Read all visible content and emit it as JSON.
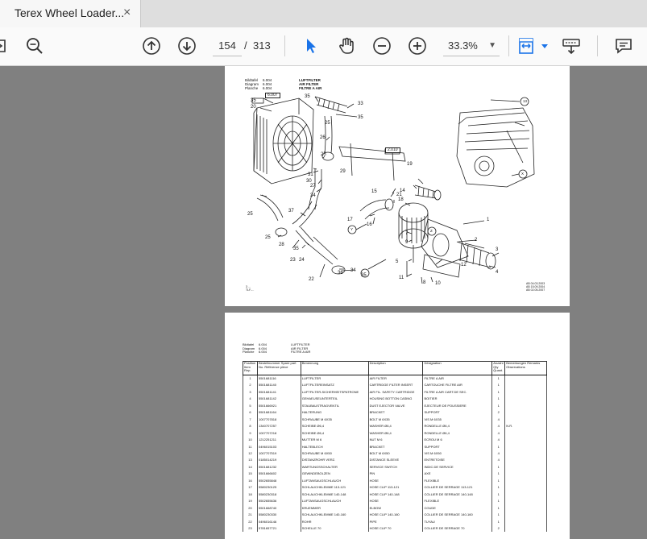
{
  "tab": {
    "title": "Terex Wheel Loader...",
    "close": "×"
  },
  "toolbar": {
    "page_current": "154",
    "page_sep": "/",
    "page_total": "313",
    "zoom": "33.3%",
    "icons": [
      "zoom-out-search-icon",
      "page-up-icon",
      "page-down-icon",
      "select-cursor-icon",
      "hand-pan-icon",
      "zoom-out-icon",
      "zoom-in-icon",
      "fit-page-icon",
      "chevron-down-icon",
      "download-icon",
      "comment-icon"
    ]
  },
  "page1": {
    "header_labels": [
      "Bildtafel",
      "Diagram",
      "Planche"
    ],
    "header_numbers": [
      "6.004",
      "6.004",
      "6.004"
    ],
    "header_titles": [
      "LUFTFILTER",
      "AIR FILTER",
      "FILTRE A AIR"
    ],
    "ref_box_1": "6.007",
    "ref_box_2": "2.010",
    "callouts": [
      "35",
      "20",
      "35",
      "33",
      "35",
      "25",
      "26",
      "25",
      "31",
      "30",
      "29",
      "27",
      "34",
      "37",
      "25",
      "25",
      "28",
      "35",
      "23",
      "24",
      "22",
      "36",
      "34",
      "35",
      "19",
      "15",
      "14",
      "18",
      "21",
      "17",
      "16",
      "1",
      "7",
      "9",
      "2",
      "3",
      "4",
      "5",
      "12",
      "11",
      "8",
      "10",
      "13",
      "Y",
      "Y",
      "X",
      "X",
      "Z",
      "Z"
    ],
    "footer_left": [
      "3 ...",
      "TLF-...",
      "..."
    ],
    "footer_right": [
      "AB 04.03.2003",
      "AB 15.09.2004",
      "AB 02.05.2007"
    ]
  },
  "page2": {
    "header_labels": [
      "Bildtafel",
      "Diagram",
      "Planche"
    ],
    "header_numbers": [
      "6.004",
      "6.004",
      "6.004"
    ],
    "header_titles": [
      "LUFTFILTER",
      "AIR FILTER",
      "FILTRE A AIR"
    ],
    "columns": [
      "Position Item Rep.",
      "Bestellnummer Spare part No. Référence pièce",
      "Benennung",
      "Description",
      "Désignation",
      "Anzahl Qty Quant.",
      "Bemerkungen Remarks Observations"
    ],
    "rows": [
      [
        "1",
        "5501681116",
        "LUFTFILTER",
        "AIR FILTER",
        "FILTRE A AIR",
        "1",
        ""
      ],
      [
        "2",
        "5501681140",
        "LUFTFILTEREINSATZ",
        "CARTRIDGE FILTER INSERT",
        "CARTOUCHE FILTRE AIR",
        "1",
        ""
      ],
      [
        "3",
        "5501681141",
        "LUFTFILTER-SICHERHEITSPATRONE",
        "AIR FIL. SAFETY CARTRIDGE",
        "FILTRE A AIR CART.DE SEC.",
        "1",
        ""
      ],
      [
        "4",
        "5501681142",
        "GEHAEUSEUNTERTEIL",
        "HOUSING BOTTON CASING",
        "BOITIER",
        "1",
        ""
      ],
      [
        "5",
        "5501666921",
        "STAUBAUSTRAGVENTIL",
        "DUST EJECTOR VALVE",
        "EJECTEUR DE POUSSIERE",
        "1",
        ""
      ],
      [
        "6",
        "5501681164",
        "HALTERUNG",
        "BRACKET",
        "SUPPORT",
        "2",
        ""
      ],
      [
        "7",
        "1007707818",
        "SCHRAUBE M 6X35",
        "BOLT M 6X35",
        "VIS M 6X35",
        "4",
        ""
      ],
      [
        "8",
        "1340707257",
        "SCHEIBE Ø6,4",
        "WASHER Ø6,4",
        "RONDELLE Ø6,4",
        "4",
        "N.R."
      ],
      [
        "9",
        "1007707218",
        "SCHEIBE Ø6,4",
        "WASHER Ø6,4",
        "RONDELLE Ø6,4",
        "4",
        ""
      ],
      [
        "10",
        "1212251211",
        "MUTTER M 6",
        "NUT M 6",
        "ECROU M 6",
        "4",
        ""
      ],
      [
        "11",
        "0496015103",
        "HALTEBLECH",
        "BRACKET",
        "SUPPORT",
        "1",
        ""
      ],
      [
        "12",
        "1007707519",
        "SCHRAUBE M 6X50",
        "BOLT M 6X50",
        "VIS M 6X50",
        "4",
        ""
      ],
      [
        "13",
        "0185014219",
        "DISTANZROHR VERZ.",
        "DISTANCE SLEEVE",
        "ENTRETOISE",
        "4",
        ""
      ],
      [
        "14",
        "5501681232",
        "WARTUNGSSCHALTER",
        "SERVICE SWITCH",
        "INDIC.DE SERVICE",
        "1",
        ""
      ],
      [
        "15",
        "5501666602",
        "GEWINDEBOLZEN",
        "PIN",
        "AXE",
        "1",
        ""
      ],
      [
        "16",
        "5502655848",
        "LUFTANSAUGSCHLAUCH",
        "HOSE",
        "FLEXIBLE",
        "1",
        ""
      ],
      [
        "17",
        "5580230125",
        "SCHLAUCHKLEMME 113-121",
        "HOSE CLIP 113-121",
        "COLLIER DE SERRAGE 113-121",
        "1",
        ""
      ],
      [
        "18",
        "5580230318",
        "SCHLAUCHKLEMME 140-148",
        "HOSE CLIP 140-148",
        "COLLIER DE SERRAGE 140-148",
        "1",
        ""
      ],
      [
        "19",
        "5502655636",
        "LUFTANSAUGSCHLAUCH",
        "HOSE",
        "FLEXIBLE",
        "1",
        ""
      ],
      [
        "20",
        "5501668740",
        "KRUEMMER",
        "ELBOW",
        "COUDE",
        "1",
        ""
      ],
      [
        "21",
        "5580230330",
        "SCHLAUCHKLEMME 140-160",
        "HOSE CLIP 140-160",
        "COLLIER DE SERRAGE 140-160",
        "1",
        ""
      ],
      [
        "22",
        "0496016146",
        "ROHR",
        "PIPE",
        "TUYAU",
        "1",
        ""
      ],
      [
        "23",
        "5781657721",
        "SCHELLE 70",
        "HOSE CLIP 70",
        "COLLIER DE SERRAGE 70",
        "2",
        ""
      ]
    ]
  }
}
